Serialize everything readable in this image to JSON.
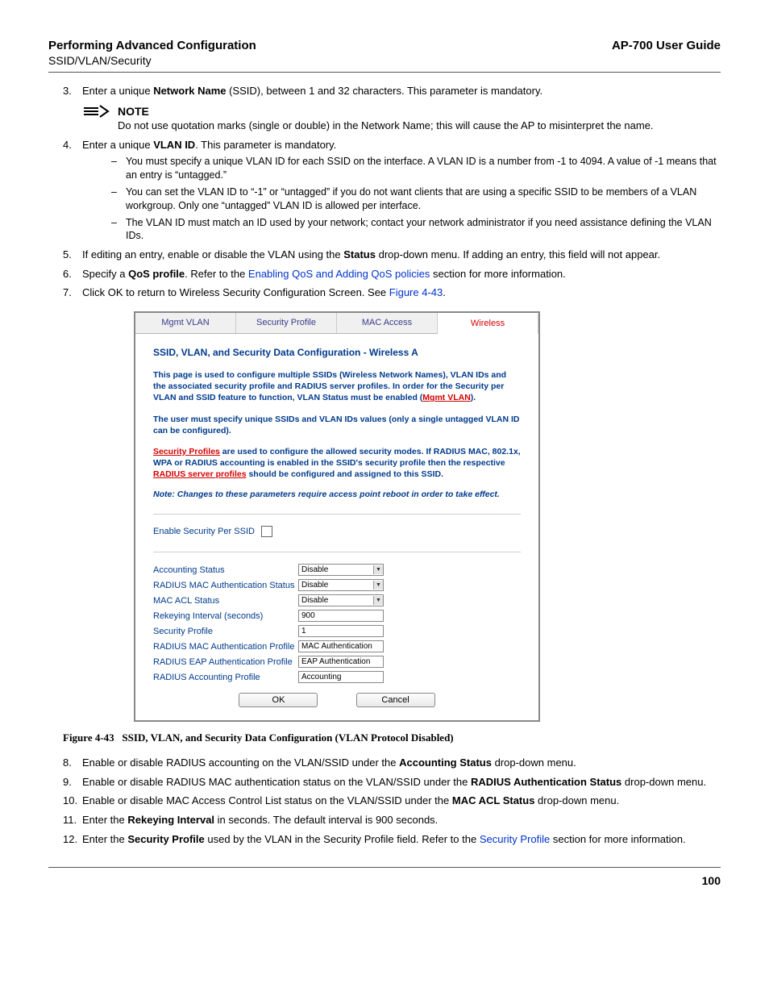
{
  "header": {
    "left": "Performing Advanced Configuration",
    "right": "AP-700 User Guide",
    "sub": "SSID/VLAN/Security"
  },
  "steps": {
    "s3_a": "Enter a unique ",
    "s3_b": "Network Name",
    "s3_c": " (SSID), between 1 and 32 characters. This parameter is mandatory.",
    "note_label": "NOTE",
    "note_body": "Do not use quotation marks (single or double) in the Network Name; this will cause the AP to misinterpret the name.",
    "s4_a": "Enter a unique ",
    "s4_b": "VLAN ID",
    "s4_c": ". This parameter is mandatory.",
    "s4_d1": "You must specify a unique VLAN ID for each SSID on the interface. A VLAN ID is a number from -1 to 4094. A value of -1 means that an entry is “untagged.”",
    "s4_d2": "You can set the VLAN ID to “-1” or “untagged” if you do not want clients that are using a specific SSID to be members of a VLAN workgroup. Only one “untagged” VLAN ID is allowed per interface.",
    "s4_d3": "The VLAN ID must match an ID used by your network; contact your network administrator if you need assistance defining the VLAN IDs.",
    "s5_a": "If editing an entry, enable or disable the VLAN using the ",
    "s5_b": "Status",
    "s5_c": " drop-down menu. If adding an entry, this field will not appear.",
    "s6_a": "Specify a ",
    "s6_b": "QoS profile",
    "s6_c": ". Refer to the ",
    "s6_link": "Enabling QoS and Adding QoS policies",
    "s6_d": " section for more information.",
    "s7_a": "Click OK to return to Wireless Security Configuration Screen. See ",
    "s7_link": "Figure 4-43",
    "s7_b": ".",
    "s8_a": "Enable or disable RADIUS accounting on the VLAN/SSID under the ",
    "s8_b": "Accounting Status",
    "s8_c": " drop-down menu.",
    "s9_a": "Enable or disable RADIUS MAC authentication status on the VLAN/SSID under the ",
    "s9_b": "RADIUS Authentication Status",
    "s9_c": " drop-down menu.",
    "s10_a": "Enable or disable MAC Access Control List status on the VLAN/SSID under the ",
    "s10_b": "MAC ACL Status",
    "s10_c": " drop-down menu.",
    "s11_a": "Enter the ",
    "s11_b": "Rekeying Interval",
    "s11_c": " in seconds. The default interval is 900 seconds.",
    "s12_a": "Enter the ",
    "s12_b": "Security Profile",
    "s12_c": " used by the VLAN in the Security Profile field. Refer to the ",
    "s12_link": "Security Profile",
    "s12_d": " section for more information."
  },
  "panel": {
    "tabs": [
      "Mgmt VLAN",
      "Security Profile",
      "MAC Access",
      "Wireless"
    ],
    "title": "SSID, VLAN, and Security Data Configuration - Wireless A",
    "p1_a": "This page is used to configure multiple SSIDs (Wireless Network Names), VLAN IDs and the associated security profile and RADIUS server profiles. In order for the Security per VLAN and SSID feature to function, VLAN Status must be enabled (",
    "p1_link": "Mgmt VLAN",
    "p1_b": ").",
    "p2": "The user must specify unique SSIDs and VLAN IDs values (only a single untagged VLAN ID can be configured).",
    "p3_link1": "Security Profiles",
    "p3_a": " are used to configure the allowed security modes. If RADIUS MAC, 802.1x, WPA or RADIUS accounting is enabled in the SSID's security profile then the respective ",
    "p3_link2": "RADIUS server profiles",
    "p3_b": " should be configured and assigned to this SSID.",
    "note": "Note: Changes to these parameters require access point reboot in order to take effect.",
    "enable_label": "Enable Security Per SSID",
    "rows": {
      "accounting_status": {
        "label": "Accounting Status",
        "value": "Disable",
        "type": "select"
      },
      "radius_mac_auth_status": {
        "label": "RADIUS MAC Authentication Status",
        "value": "Disable",
        "type": "select"
      },
      "mac_acl_status": {
        "label": "MAC ACL Status",
        "value": "Disable",
        "type": "select"
      },
      "rekeying_interval": {
        "label": "Rekeying Interval (seconds)",
        "value": "900",
        "type": "text"
      },
      "security_profile": {
        "label": "Security Profile",
        "value": "1",
        "type": "text"
      },
      "radius_mac_auth_profile": {
        "label": "RADIUS MAC Authentication Profile",
        "value": "MAC Authentication",
        "type": "text"
      },
      "radius_eap_auth_profile": {
        "label": "RADIUS EAP Authentication Profile",
        "value": "EAP Authentication",
        "type": "text"
      },
      "radius_accounting_profile": {
        "label": "RADIUS Accounting Profile",
        "value": "Accounting",
        "type": "text"
      }
    },
    "ok": "OK",
    "cancel": "Cancel"
  },
  "figure": {
    "num": "Figure 4-43",
    "title": "SSID, VLAN, and Security Data Configuration (VLAN Protocol Disabled)"
  },
  "footer": {
    "page": "100"
  }
}
